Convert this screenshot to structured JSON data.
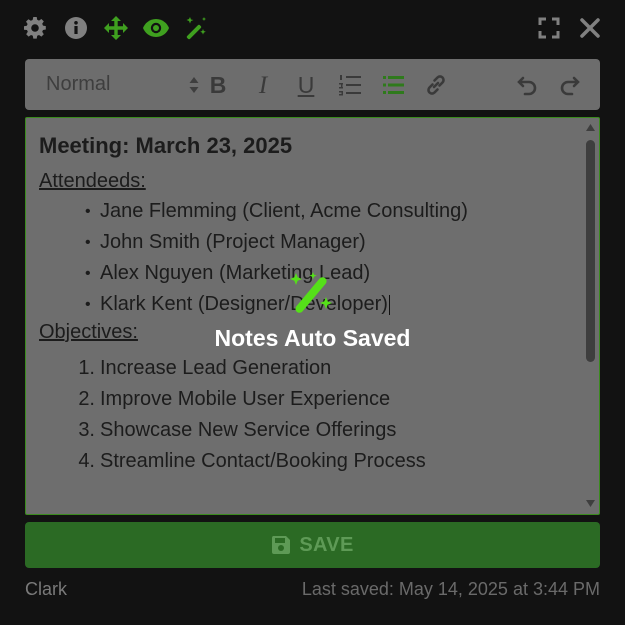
{
  "topbar": {
    "icons": [
      "gear-icon",
      "info-icon",
      "move-icon",
      "eye-icon",
      "magic-wand-icon",
      "fullscreen-icon",
      "close-icon"
    ],
    "active_color": "#3fa01f",
    "muted_color": "#7a7a7a"
  },
  "toolbar": {
    "format_select": "Normal",
    "buttons": {
      "bold": "B",
      "italic": "I",
      "underline": "U"
    }
  },
  "editor": {
    "title": "Meeting: March 23, 2025",
    "attendees_heading": "Attendeeds:",
    "attendees": [
      "Jane Flemming (Client, Acme Consulting)",
      "John Smith (Project Manager)",
      "Alex Nguyen (Marketing Lead)",
      "Klark Kent (Designer/Developer)"
    ],
    "objectives_heading": "Objectives:",
    "objectives": [
      {
        "n": "1.",
        "text": "Increase Lead Generation"
      },
      {
        "n": "2.",
        "text": "Improve Mobile User Experience"
      },
      {
        "n": "3.",
        "text": "Showcase New Service Offerings"
      },
      {
        "n": "4.",
        "text": "Streamline Contact/Booking Process"
      }
    ]
  },
  "overlay": {
    "label": "Notes Auto Saved",
    "icon": "magic-wand-icon",
    "color": "#55e019"
  },
  "save": {
    "label": "SAVE",
    "icon": "floppy-disk-icon"
  },
  "footer": {
    "user": "Clark",
    "last_saved": "Last saved: May 14, 2025 at 3:44 PM"
  }
}
